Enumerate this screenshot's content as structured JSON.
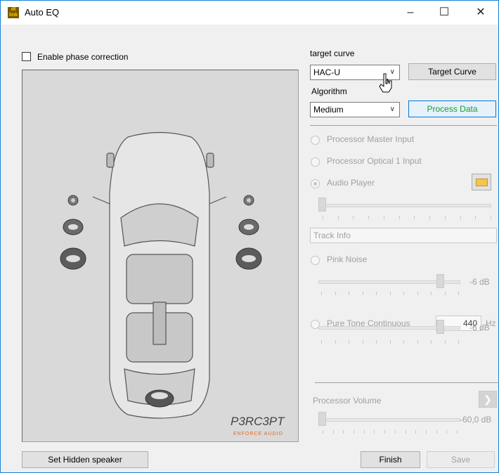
{
  "window": {
    "title": "Auto EQ",
    "minimize": "–",
    "maximize": "☐",
    "close": "✕"
  },
  "phase": {
    "label": "Enable phase correction",
    "checked": false
  },
  "target_curve": {
    "label": "target curve",
    "value": "HAC-U",
    "button": "Target Curve"
  },
  "algorithm": {
    "label": "Algorithm",
    "value": "Medium",
    "button": "Process Data"
  },
  "sources": {
    "master": "Processor Master Input",
    "optical": "Processor Optical 1 Input",
    "player": "Audio Player",
    "track_info": "Track Info",
    "pink_noise": "Pink Noise",
    "pink_db": "-6 dB",
    "pure_tone": "Pure Tone Continuous",
    "tone_freq": "440",
    "tone_unit": "Hz",
    "tone_db": "-6 dB"
  },
  "volume": {
    "label": "Processor Volume",
    "value": "-60,0 dB"
  },
  "logo": {
    "brand": "P3RC3PT",
    "sub": "ENFORCE AUDIO"
  },
  "buttons": {
    "hidden": "Set Hidden speaker",
    "finish": "Finish",
    "save": "Save"
  }
}
